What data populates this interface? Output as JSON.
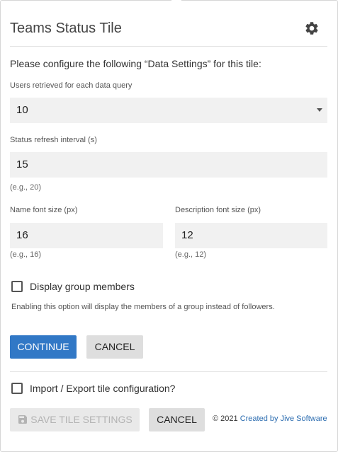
{
  "header": {
    "title": "Teams Status Tile",
    "settings_icon": "gear-icon"
  },
  "intro": "Please configure the following “Data Settings” for this tile:",
  "fields": {
    "users_query": {
      "label": "Users retrieved for each data query",
      "value": "10"
    },
    "refresh_interval": {
      "label": "Status refresh interval (s)",
      "value": "15",
      "hint": "(e.g., 20)"
    },
    "name_font": {
      "label": "Name font size (px)",
      "value": "16",
      "hint": "(e.g., 16)"
    },
    "description_font": {
      "label": "Description font size (px)",
      "value": "12",
      "hint": "(e.g., 12)"
    }
  },
  "group_members": {
    "label": "Display group members",
    "checked": false,
    "note": "Enabling this option will display the members of a group instead of followers."
  },
  "actions": {
    "continue_label": "CONTINUE",
    "cancel_label": "CANCEL"
  },
  "import_export": {
    "label": "Import / Export tile configuration?",
    "checked": false
  },
  "footer": {
    "save_label": "SAVE TILE SETTINGS",
    "save_icon": "floppy-disk-icon",
    "cancel_label": "CANCEL",
    "copyright": "© 2021",
    "credit_link": "Created by Jive Software"
  },
  "colors": {
    "primary": "#3178c6",
    "link": "#2b6cb0"
  }
}
